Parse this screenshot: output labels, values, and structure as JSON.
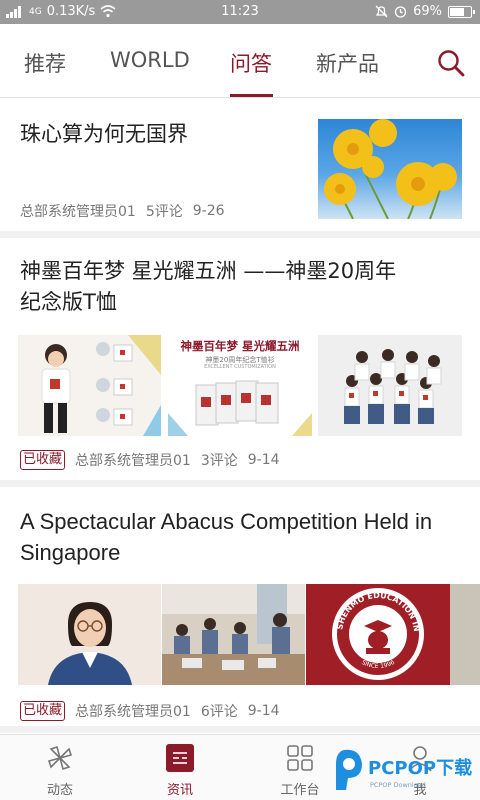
{
  "status_bar": {
    "signal_text": "4G",
    "speed": "0.13K/s",
    "time": "11:23",
    "battery": "69%",
    "battery_level": 0.69
  },
  "tabs": [
    {
      "label": "推荐",
      "active": false
    },
    {
      "label": "WORLD",
      "active": false
    },
    {
      "label": "问答",
      "active": true
    },
    {
      "label": "新产品",
      "active": false
    }
  ],
  "search_icon": "search-icon",
  "articles": [
    {
      "title": "珠心算为何无国界",
      "author": "总部系统管理员01",
      "comments": "5评论",
      "date": "9-26"
    },
    {
      "title_line1": "神墨百年梦 星光耀五洲 ——神墨20周年",
      "title_line2": "纪念版T恤",
      "tag": "已收藏",
      "author": "总部系统管理员01",
      "comments": "3评论",
      "date": "9-14",
      "image2_title": "神墨百年梦 星光耀五洲",
      "image2_sub": "神墨20周年纪念T恤衫",
      "image2_sub2": "EXCELLENT CUSTOMIZATION"
    },
    {
      "title_line1": "A Spectacular Abacus Competition Held in",
      "title_line2": "Singapore",
      "tag": "已收藏",
      "author": "总部系统管理员01",
      "comments": "6评论",
      "date": "9-14",
      "seal_text": "SHENMO EDUCATION INT",
      "seal_since": "SINCE 1996"
    }
  ],
  "bottom_nav": [
    {
      "label": "动态",
      "icon": "pinwheel-icon",
      "active": false
    },
    {
      "label": "资讯",
      "icon": "news-icon",
      "active": true
    },
    {
      "label": "工作台",
      "icon": "grid-icon",
      "active": false
    },
    {
      "label": "我",
      "icon": "profile-icon",
      "active": false
    }
  ],
  "watermark": {
    "brand": "PCPOP下载",
    "sub": "PCPOP Download"
  },
  "colors": {
    "accent": "#8b1a2b",
    "status_bar": "#9a9a9a"
  }
}
